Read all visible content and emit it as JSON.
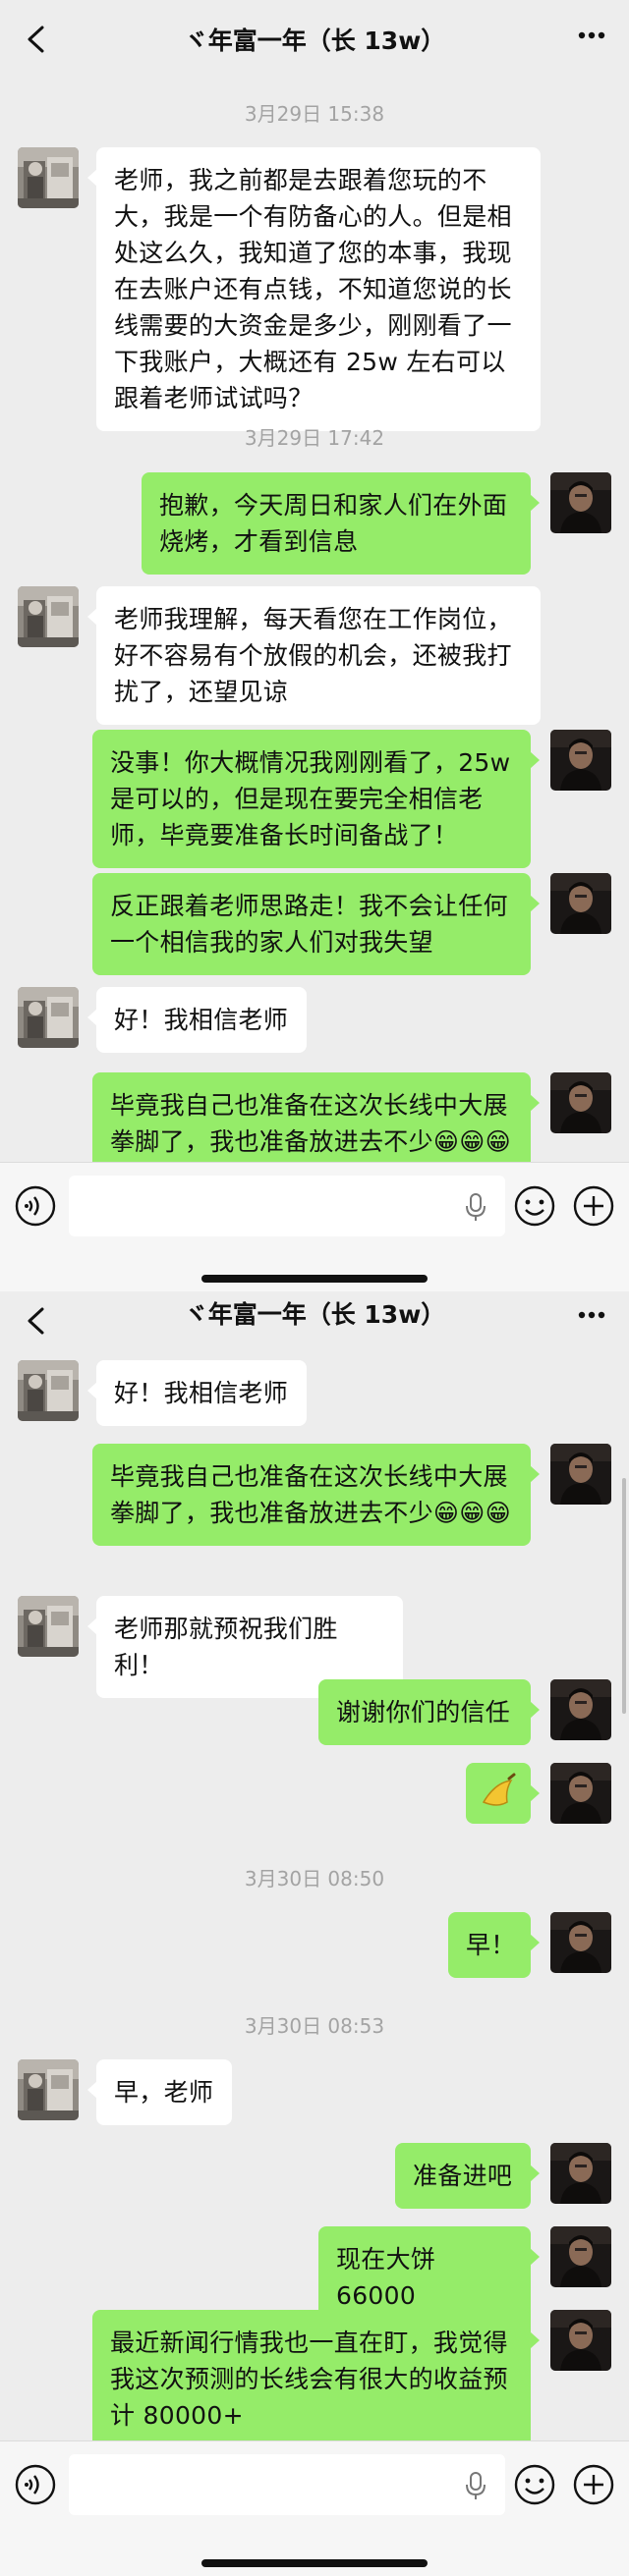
{
  "chat_title": "ヾ年富一年（长 13w）",
  "colors": {
    "background": "#ededed",
    "incoming_bubble": "#ffffff",
    "outgoing_bubble": "#95ec69",
    "timestamp": "#a3a3a3"
  },
  "icons": {
    "back": "chevron-left-icon",
    "more": "more-dots-icon",
    "voice": "voice-icon",
    "mic": "microphone-icon",
    "emoji": "emoji-icon",
    "plus": "plus-icon",
    "banana": "banana-icon"
  },
  "screen1": {
    "timestamps": [
      "3月29日 15:38",
      "3月29日 17:42"
    ],
    "messages": [
      {
        "from": "student",
        "text": "老师，我之前都是去跟着您玩的不大，我是一个有防备心的人。但是相处这么久，我知道了您的本事，我现在去账户还有点钱，不知道您说的长线需要的大资金是多少，刚刚看了一下我账户，大概还有 25w 左右可以跟着老师试试吗？"
      },
      {
        "from": "teacher",
        "text": "抱歉，今天周日和家人们在外面烧烤，才看到信息"
      },
      {
        "from": "student",
        "text": "老师我理解，每天看您在工作岗位，好不容易有个放假的机会，还被我打扰了，还望见谅"
      },
      {
        "from": "teacher",
        "text": "没事！你大概情况我刚刚看了，25w 是可以的，但是现在要完全相信老师，毕竟要准备长时间备战了！"
      },
      {
        "from": "teacher",
        "text": "反正跟着老师思路走！我不会让任何一个相信我的家人们对我失望"
      },
      {
        "from": "student",
        "text": "好！我相信老师"
      },
      {
        "from": "teacher",
        "text": "毕竟我自己也准备在这次长线中大展拳脚了，我也准备放进去不少😁😁😁"
      }
    ]
  },
  "screen2": {
    "timestamps": [
      "3月30日 08:50",
      "3月30日 08:53"
    ],
    "messages": [
      {
        "from": "student",
        "text": "好！我相信老师"
      },
      {
        "from": "teacher",
        "text": "毕竟我自己也准备在这次长线中大展拳脚了，我也准备放进去不少😁😁😁"
      },
      {
        "from": "student",
        "text": "老师那就预祝我们胜利！"
      },
      {
        "from": "teacher",
        "text": "谢谢你们的信任"
      },
      {
        "from": "teacher",
        "text": "banana"
      },
      {
        "from": "teacher",
        "text": "早！"
      },
      {
        "from": "student",
        "text": "早，老师"
      },
      {
        "from": "teacher",
        "text": "准备进吧"
      },
      {
        "from": "teacher",
        "text": "现在大饼 66000"
      },
      {
        "from": "teacher",
        "text": "最近新闻行情我也一直在盯，我觉得我这次预测的长线会有很大的收益预计 80000+"
      }
    ]
  }
}
